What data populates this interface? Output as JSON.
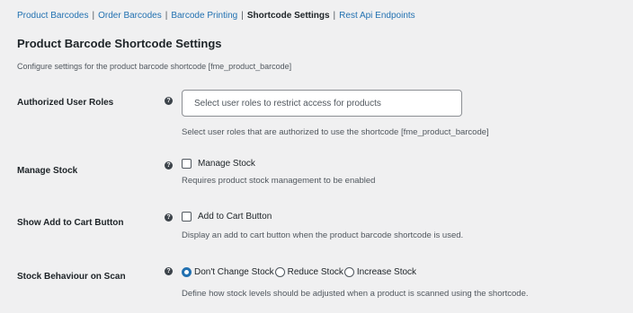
{
  "tabs": [
    {
      "label": "Product Barcodes",
      "active": false
    },
    {
      "label": "Order Barcodes",
      "active": false
    },
    {
      "label": "Barcode Printing",
      "active": false
    },
    {
      "label": "Shortcode Settings",
      "active": true
    },
    {
      "label": "Rest Api Endpoints",
      "active": false
    }
  ],
  "separator": "|",
  "page_title": "Product Barcode Shortcode Settings",
  "page_description": "Configure settings for the product barcode shortcode [fme_product_barcode]",
  "help_icon": "?",
  "settings": {
    "roles": {
      "label": "Authorized User Roles",
      "placeholder": "Select user roles to restrict access for products",
      "help": "Select user roles that are authorized to use the shortcode [fme_product_barcode]"
    },
    "manage_stock": {
      "label": "Manage Stock",
      "checkbox_label": "Manage Stock",
      "checked": false,
      "help": "Requires product stock management to be enabled"
    },
    "add_to_cart": {
      "label": "Show Add to Cart Button",
      "checkbox_label": "Add to Cart Button",
      "checked": false,
      "help": "Display an add to cart button when the product barcode shortcode is used."
    },
    "stock_behaviour": {
      "label": "Stock Behaviour on Scan",
      "options": [
        {
          "label": "Don't Change Stock",
          "selected": true
        },
        {
          "label": "Reduce Stock",
          "selected": false
        },
        {
          "label": "Increase Stock",
          "selected": false
        }
      ],
      "help": "Define how stock levels should be adjusted when a product is scanned using the shortcode."
    }
  },
  "colors": {
    "link": "#2271b1",
    "background": "#f0f0f1",
    "radio_selected": "#2271b1"
  }
}
